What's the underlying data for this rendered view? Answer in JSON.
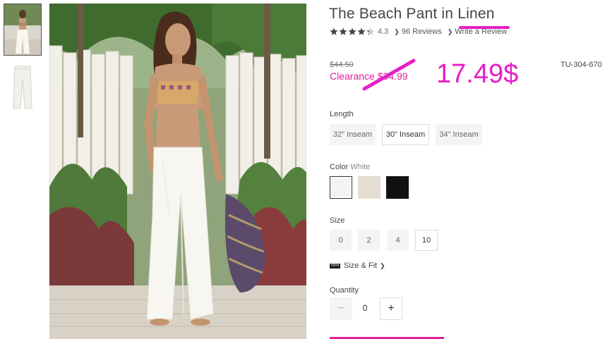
{
  "colors": {
    "accent": "#e21f9c",
    "annotation": "#e61ec8",
    "swatch_white": "#f3f3f6",
    "swatch_natural": "#e4ddd0",
    "swatch_black": "#111111"
  },
  "gallery": {
    "thumbnails": [
      {
        "name": "model-in-beach-pant-thumbnail",
        "active": true
      },
      {
        "name": "flat-pant-thumbnail",
        "active": false
      }
    ]
  },
  "product": {
    "title": "The Beach Pant in Linen",
    "rating_value": 4.3,
    "rating_text": "4.3",
    "reviews_text": "96 Reviews",
    "write_review_text": "Write a Review",
    "original_price": "$44.50",
    "clearance_text": "Clearance $34.99",
    "sku": "TU-304-670"
  },
  "annotations": {
    "handwritten_price": "17.49$"
  },
  "options": {
    "length": {
      "label": "Length",
      "choices": [
        "32\" Inseam",
        "30\" Inseam",
        "34\" Inseam"
      ],
      "selected": "30\" Inseam"
    },
    "color": {
      "label": "Color",
      "selected_name": "White",
      "swatches": [
        {
          "name": "white-swatch",
          "color_key": "swatch_white",
          "selected": true
        },
        {
          "name": "natural-swatch",
          "color_key": "swatch_natural",
          "selected": false
        },
        {
          "name": "black-swatch",
          "color_key": "swatch_black",
          "selected": false
        }
      ]
    },
    "size": {
      "label": "Size",
      "choices": [
        "0",
        "2",
        "4",
        "10"
      ],
      "selected": "10"
    },
    "size_fit_text": "Size & Fit",
    "size_fit_icon": "ruler-icon"
  },
  "quantity": {
    "label": "Quantity",
    "value": "0",
    "minus_symbol": "−",
    "plus_symbol": "+"
  }
}
